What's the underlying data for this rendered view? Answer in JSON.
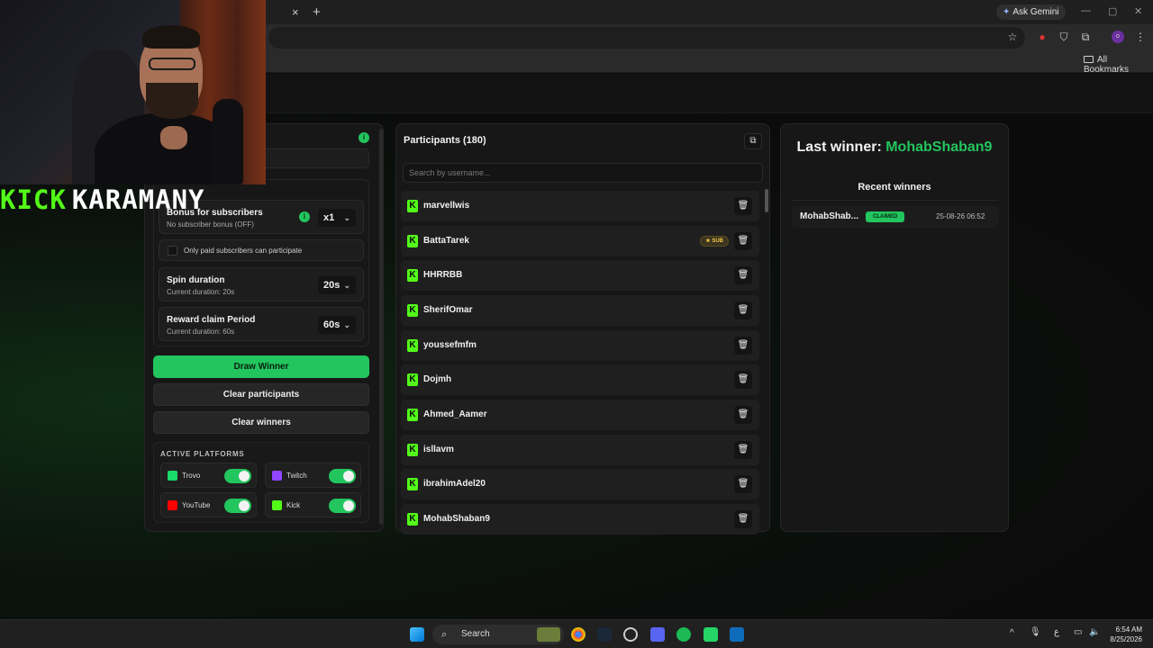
{
  "browser": {
    "gemini_label": "Ask Gemini",
    "bookmarks_label": "All Bookmarks",
    "tab_close": "×",
    "tab_new": "+"
  },
  "streamer": {
    "part1": "KICK",
    "part2": "KARAMANY"
  },
  "settings": {
    "subscriber_bonus": {
      "title": "Bonus for subscribers",
      "subtitle": "No subscriber bonus (OFF)",
      "value": "x1"
    },
    "paid_only_label": "Only paid subscribers can participate",
    "spin_duration": {
      "title": "Spin duration",
      "subtitle": "Current duration: 20s",
      "value": "20s"
    },
    "reward_claim": {
      "title": "Reward claim Period",
      "subtitle": "Current duration: 60s",
      "value": "60s"
    },
    "draw_winner": "Draw Winner",
    "clear_participants": "Clear participants",
    "clear_winners": "Clear winners",
    "platforms_heading": "ACTIVE PLATFORMS",
    "platforms": [
      {
        "name": "Trovo",
        "color": "#1bd96a",
        "enabled": true
      },
      {
        "name": "Twitch",
        "color": "#9146ff",
        "enabled": true
      },
      {
        "name": "YouTube",
        "color": "#ff0000",
        "enabled": true
      },
      {
        "name": "Kick",
        "color": "#53fc18",
        "enabled": true
      }
    ]
  },
  "participants": {
    "heading": "Participants (180)",
    "search_placeholder": "Search by username...",
    "sub_badge": "SUB",
    "list": [
      {
        "name": "marvellwis",
        "sub": false
      },
      {
        "name": "BattaTarek",
        "sub": true
      },
      {
        "name": "HHRRBB",
        "sub": false
      },
      {
        "name": "SherifOmar",
        "sub": false
      },
      {
        "name": "youssefmfm",
        "sub": false
      },
      {
        "name": "Dojmh",
        "sub": false
      },
      {
        "name": "Ahmed_Aamer",
        "sub": false
      },
      {
        "name": "isllavm",
        "sub": false
      },
      {
        "name": "ibrahimAdel20",
        "sub": false
      },
      {
        "name": "MohabShaban9",
        "sub": false
      }
    ]
  },
  "winners": {
    "last_winner_label": "Last winner:",
    "last_winner_name": "MohabShaban9",
    "recent_heading": "Recent winners",
    "recent": [
      {
        "name": "MohabShab...",
        "status": "CLAIMED",
        "date": "25-08-26 06:52"
      }
    ]
  },
  "taskbar": {
    "search_label": "Search",
    "time": "6:54 AM",
    "date": "8/25/2026",
    "lang": "ع"
  },
  "colors": {
    "accent": "#22c55e",
    "kick": "#53fc18",
    "background": "#0d0d0d",
    "panel": "#171717"
  }
}
